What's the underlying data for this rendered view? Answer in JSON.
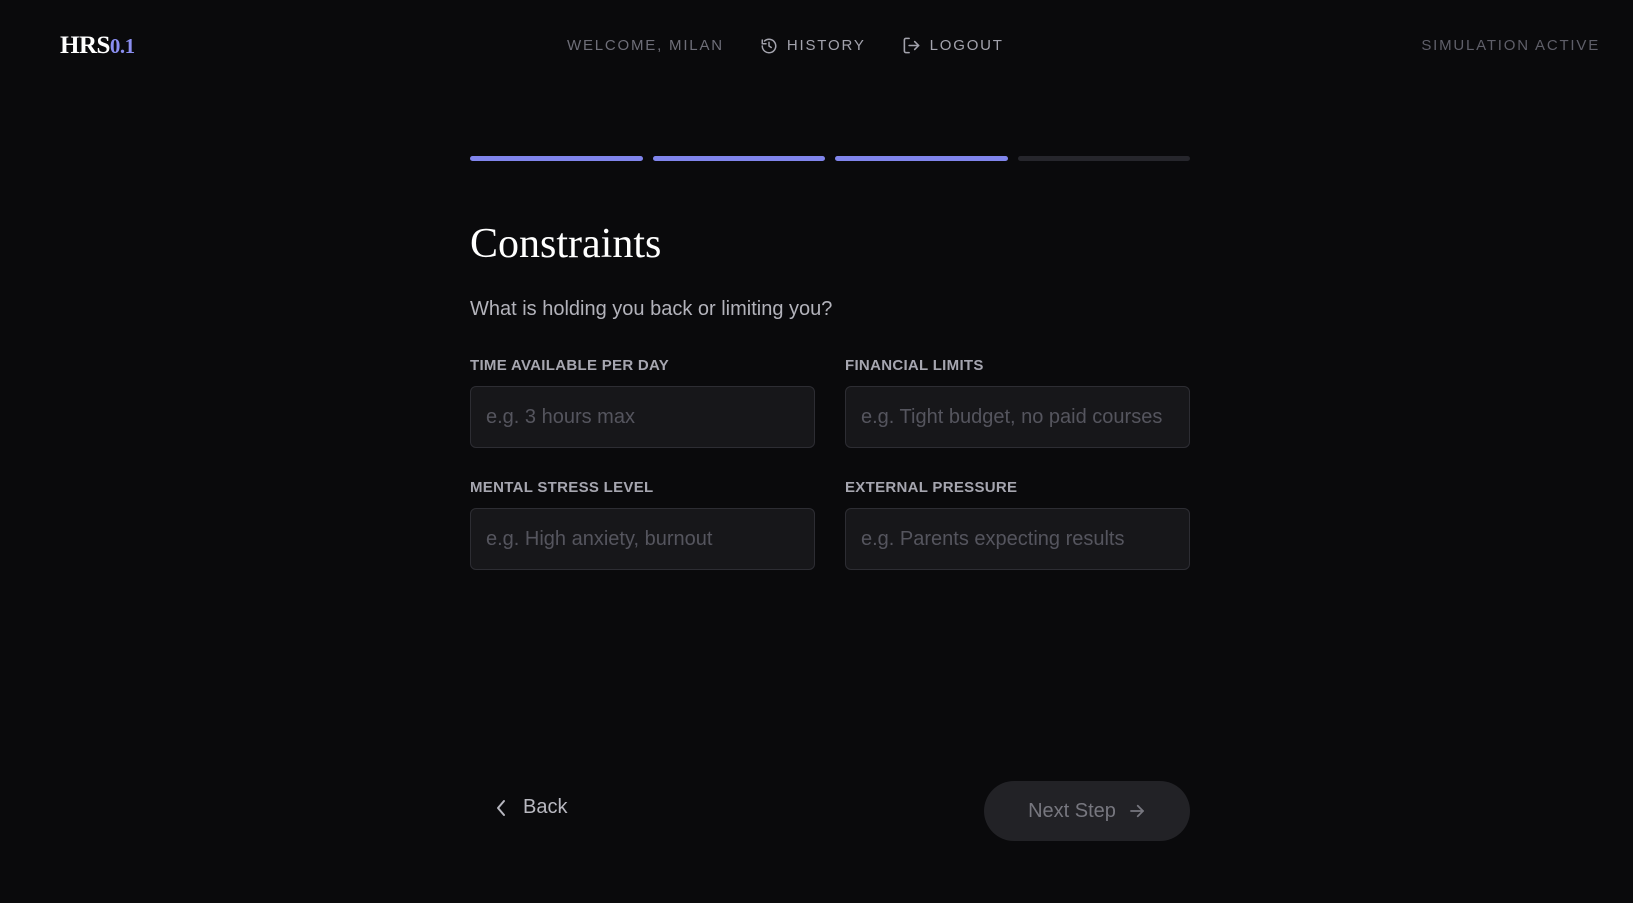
{
  "header": {
    "logo_main": "HRS",
    "logo_version": "0.1",
    "welcome": "WELCOME, MILAN",
    "history_label": "HISTORY",
    "logout_label": "LOGOUT",
    "status": "SIMULATION ACTIVE"
  },
  "progress": {
    "total_steps": 4,
    "completed_steps": 3,
    "accent_color": "#8085ec"
  },
  "step": {
    "title": "Constraints",
    "subtitle": "What is holding you back or limiting you?"
  },
  "fields": [
    {
      "label": "TIME AVAILABLE PER DAY",
      "value": "",
      "placeholder": "e.g. 3 hours max"
    },
    {
      "label": "FINANCIAL LIMITS",
      "value": "",
      "placeholder": "e.g. Tight budget, no paid courses"
    },
    {
      "label": "MENTAL STRESS LEVEL",
      "value": "",
      "placeholder": "e.g. High anxiety, burnout"
    },
    {
      "label": "EXTERNAL PRESSURE",
      "value": "",
      "placeholder": "e.g. Parents expecting results"
    }
  ],
  "actions": {
    "back_label": "Back",
    "next_label": "Next Step"
  },
  "icons": {
    "history": "history-icon",
    "logout": "logout-icon",
    "back": "chevron-left-icon",
    "next": "arrow-right-icon"
  }
}
